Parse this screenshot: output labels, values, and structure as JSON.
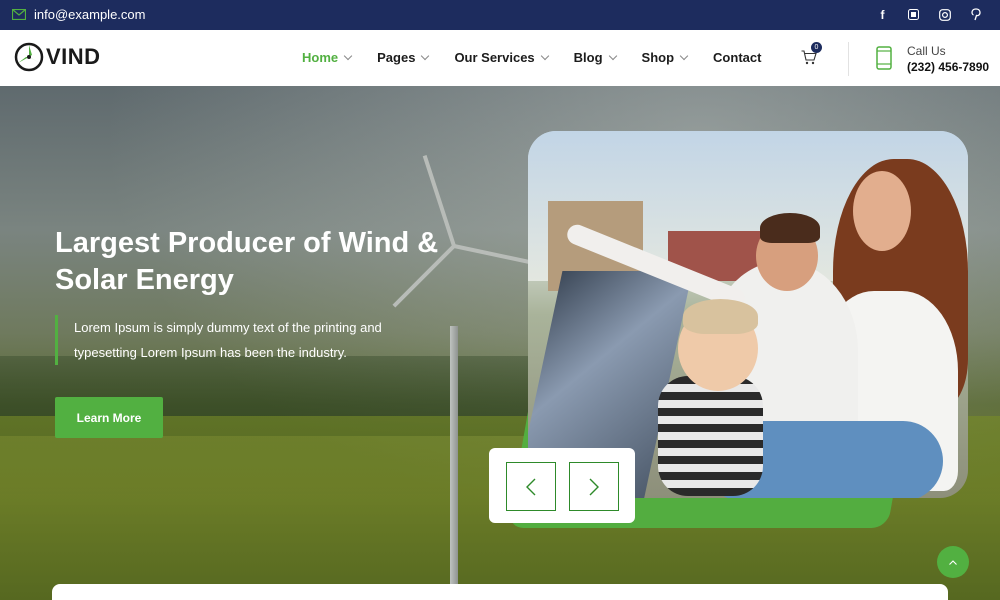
{
  "topbar": {
    "email": "info@example.com",
    "socials": [
      "facebook-icon",
      "blogger-icon",
      "instagram-icon",
      "pinterest-icon"
    ]
  },
  "header": {
    "logo_text": "VIND",
    "nav": [
      {
        "label": "Home",
        "active": true,
        "has_dropdown": true
      },
      {
        "label": "Pages",
        "active": false,
        "has_dropdown": true
      },
      {
        "label": "Our Services",
        "active": false,
        "has_dropdown": true
      },
      {
        "label": "Blog",
        "active": false,
        "has_dropdown": true
      },
      {
        "label": "Shop",
        "active": false,
        "has_dropdown": true
      },
      {
        "label": "Contact",
        "active": false,
        "has_dropdown": false
      }
    ],
    "cart_count": "0",
    "call_label": "Call Us",
    "call_number": "(232) 456-7890"
  },
  "hero": {
    "title": "Largest Producer of Wind & Solar Energy",
    "text": "Lorem Ipsum is simply dummy text of the printing and typesetting Lorem Ipsum has been the industry.",
    "button_label": "Learn More"
  },
  "colors": {
    "accent": "#52b041",
    "navy": "#1d2c5e"
  }
}
